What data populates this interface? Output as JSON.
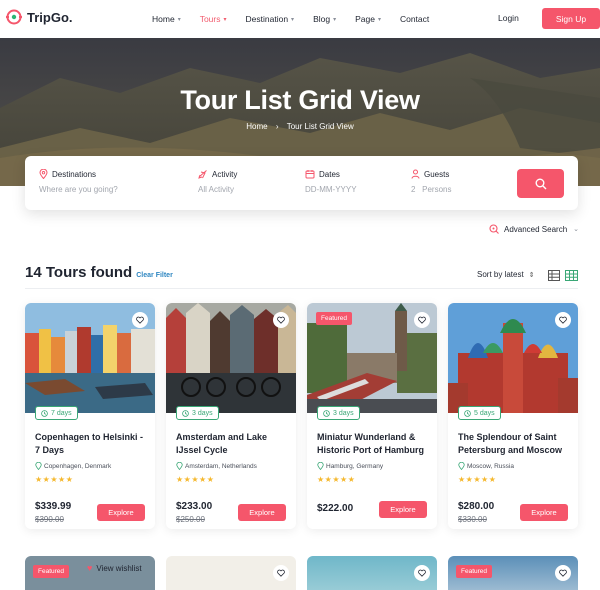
{
  "nav": {
    "brand": "TripGo.",
    "menu": [
      {
        "label": "Home",
        "has_caret": true
      },
      {
        "label": "Tours",
        "has_caret": true,
        "active": true
      },
      {
        "label": "Destination",
        "has_caret": true
      },
      {
        "label": "Blog",
        "has_caret": true
      },
      {
        "label": "Page",
        "has_caret": true
      },
      {
        "label": "Contact",
        "has_caret": false
      }
    ],
    "login": "Login",
    "signup": "Sign Up"
  },
  "hero": {
    "title": "Tour List Grid View",
    "breadcrumb": [
      "Home",
      "Tour List Grid View"
    ]
  },
  "search": {
    "destinations": {
      "label": "Destinations",
      "placeholder": "Where are you going?"
    },
    "activity": {
      "label": "Activity",
      "placeholder": "All Activity"
    },
    "dates": {
      "label": "Dates",
      "placeholder": "DD-MM-YYYY"
    },
    "guests": {
      "label": "Guests",
      "count": "2",
      "unit": "Persons"
    },
    "advanced": "Advanced Search"
  },
  "results": {
    "count_text": "14 Tours found",
    "clear": "Clear Filter",
    "sort": "Sort by latest"
  },
  "colors": {
    "accent": "#f5566b",
    "green": "#3aa776",
    "star": "#f5b82e",
    "link": "#2e86c1"
  },
  "tours": [
    {
      "title": "Copenhagen to Helsinki - 7 Days",
      "location": "Copenhagen, Denmark",
      "days": "7 days",
      "price": "$339.99",
      "old_price": "$390.00",
      "featured": false,
      "rating": 5,
      "explore": "Explore"
    },
    {
      "title": "Amsterdam and Lake IJssel Cycle",
      "location": "Amsterdam, Netherlands",
      "days": "3 days",
      "price": "$233.00",
      "old_price": "$250.00",
      "featured": false,
      "rating": 5,
      "explore": "Explore"
    },
    {
      "title": "Miniatur Wunderland & Historic Port of Hamburg",
      "location": "Hamburg, Germany",
      "days": "3 days",
      "price": "$222.00",
      "old_price": "",
      "featured": true,
      "featured_label": "Featured",
      "rating": 5,
      "explore": "Explore"
    },
    {
      "title": "The Splendour of Saint Petersburg and Moscow",
      "location": "Moscow, Russia",
      "days": "5 days",
      "price": "$280.00",
      "old_price": "$330.00",
      "featured": false,
      "rating": 5,
      "explore": "Explore"
    }
  ],
  "bottom_row": {
    "featured_label": "Featured",
    "wishlist": "View wishlist"
  }
}
